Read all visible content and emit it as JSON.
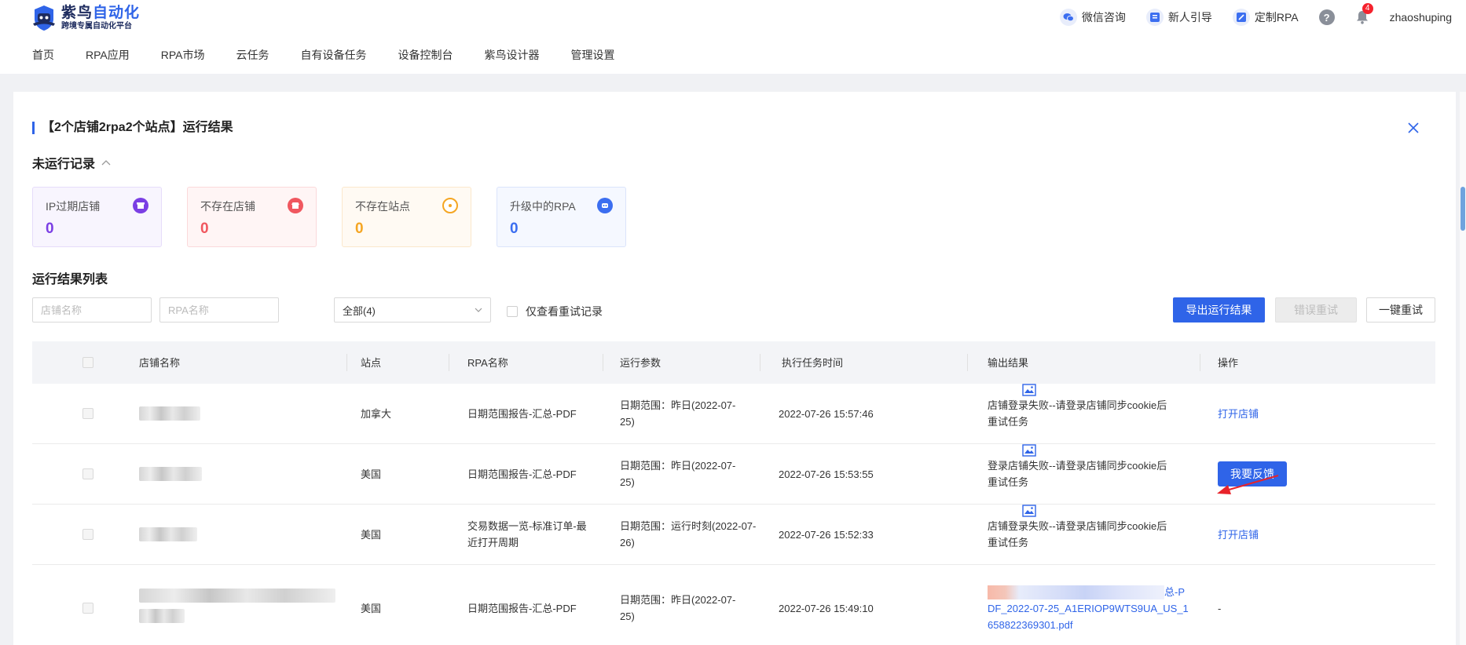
{
  "app": {
    "brand_main_a": "紫鸟",
    "brand_main_b": "自动化",
    "brand_sub": "跨境专属自动化平台"
  },
  "header": {
    "actions": [
      {
        "label": "微信咨询",
        "icon": "wechat-icon"
      },
      {
        "label": "新人引导",
        "icon": "guide-icon"
      },
      {
        "label": "定制RPA",
        "icon": "custom-rpa-icon"
      }
    ],
    "help_glyph": "?",
    "notification_count": "4",
    "username": "zhaoshuping"
  },
  "nav": {
    "items": [
      "首页",
      "RPA应用",
      "RPA市场",
      "云任务",
      "自有设备任务",
      "设备控制台",
      "紫鸟设计器",
      "管理设置"
    ]
  },
  "panel": {
    "title": "【2个店铺2rpa2个站点】运行结果",
    "unrun_section": "未运行记录",
    "list_section": "运行结果列表"
  },
  "cards": [
    {
      "label": "IP过期店铺",
      "value": "0",
      "color": "#7b3fe4",
      "bg": "#f8f5fe",
      "border": "#e6dcfa",
      "icon": "shop-icon"
    },
    {
      "label": "不存在店铺",
      "value": "0",
      "color": "#f0575f",
      "bg": "#fff5f5",
      "border": "#fbd9db",
      "icon": "store-icon"
    },
    {
      "label": "不存在站点",
      "value": "0",
      "color": "#f5a623",
      "bg": "#fffaf3",
      "border": "#fbe8cc",
      "icon": "site-icon"
    },
    {
      "label": "升级中的RPA",
      "value": "0",
      "color": "#3b6ef0",
      "bg": "#f5f8ff",
      "border": "#dbe4fb",
      "icon": "rpa-icon"
    }
  ],
  "filters": {
    "shop_placeholder": "店铺名称",
    "rpa_placeholder": "RPA名称",
    "status_value": "全部(4)",
    "retry_only_label": "仅查看重试记录",
    "export_label": "导出运行结果",
    "retry_error_label": "错误重试",
    "retry_all_label": "一键重试"
  },
  "table": {
    "columns": [
      "店铺名称",
      "站点",
      "RPA名称",
      "运行参数",
      "执行任务时间",
      "输出结果",
      "操作"
    ],
    "rows": [
      {
        "site": "加拿大",
        "rpa": "日期范围报告-汇总-PDF",
        "param": "日期范围：昨日(2022-07-25)",
        "time": "2022-07-26 15:57:46",
        "output": "店铺登录失败--请登录店铺同步cookie后重试任务",
        "action": "打开店铺"
      },
      {
        "site": "美国",
        "rpa": "日期范围报告-汇总-PDF",
        "param": "日期范围：昨日(2022-07-25)",
        "time": "2022-07-26 15:53:55",
        "output": "登录店铺失败--请登录店铺同步cookie后重试任务",
        "action": "我要反馈"
      },
      {
        "site": "美国",
        "rpa": "交易数据一览-标准订单-最近打开周期",
        "param": "日期范围：运行时刻(2022-07-26)",
        "time": "2022-07-26 15:52:33",
        "output": "店铺登录失败--请登录店铺同步cookie后重试任务",
        "action": "打开店铺"
      },
      {
        "site": "美国",
        "rpa": "日期范围报告-汇总-PDF",
        "param": "日期范围：昨日(2022-07-25)",
        "time": "2022-07-26 15:49:10",
        "output_suffix": "总-P",
        "output_file": "DF_2022-07-25_A1ERIOP9WTS9UA_US_1658822369301.pdf",
        "action": "-"
      }
    ]
  },
  "colors": {
    "accent": "#2f64e8",
    "arrow": "#e8232a"
  }
}
